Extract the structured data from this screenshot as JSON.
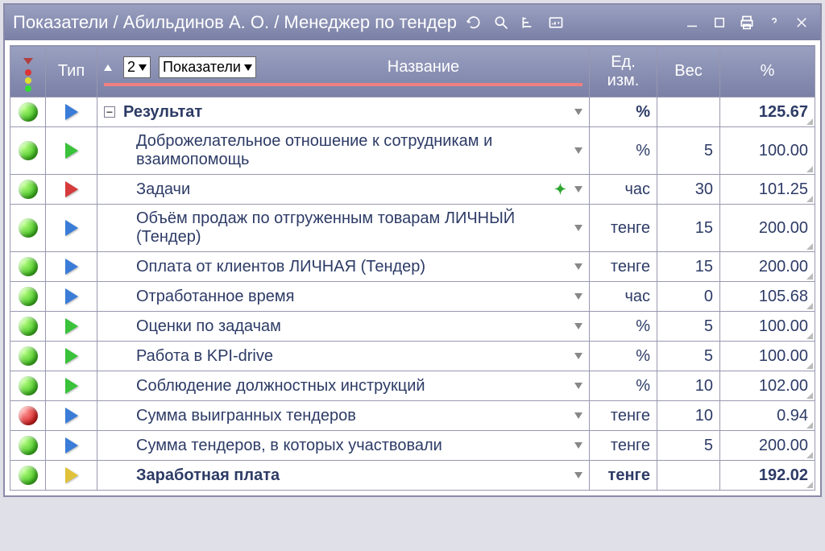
{
  "titlebar": {
    "title": "Показатели / Абильдинов А. О. / Менеджер по тендер"
  },
  "header": {
    "type_label": "Тип",
    "level_value": "2",
    "branch_label": "Показатели",
    "name_label": "Название",
    "unit_label": "Ед. изм.",
    "weight_label": "Вес",
    "percent_label": "%"
  },
  "rows": [
    {
      "status": "green",
      "type": "blue",
      "bold": true,
      "expand": true,
      "name": "Результат",
      "icon": "",
      "unit": "%",
      "weight": "",
      "pct": "125.67"
    },
    {
      "status": "green",
      "type": "green",
      "bold": false,
      "expand": false,
      "name": "Доброжелательное отношение к сотрудникам и взаимопомощь",
      "icon": "",
      "unit": "%",
      "weight": "5",
      "pct": "100.00"
    },
    {
      "status": "green",
      "type": "red",
      "bold": false,
      "expand": false,
      "name": "Задачи",
      "icon": "plus",
      "unit": "час",
      "weight": "30",
      "pct": "101.25"
    },
    {
      "status": "green",
      "type": "blue",
      "bold": false,
      "expand": false,
      "name": "Объём продаж по отгруженным товарам ЛИЧНЫЙ (Тендер)",
      "icon": "",
      "unit": "тенге",
      "weight": "15",
      "pct": "200.00"
    },
    {
      "status": "green",
      "type": "blue",
      "bold": false,
      "expand": false,
      "name": "Оплата от клиентов ЛИЧНАЯ (Тендер)",
      "icon": "",
      "unit": "тенге",
      "weight": "15",
      "pct": "200.00"
    },
    {
      "status": "green",
      "type": "blue",
      "bold": false,
      "expand": false,
      "name": "Отработанное время",
      "icon": "",
      "unit": "час",
      "weight": "0",
      "pct": "105.68"
    },
    {
      "status": "green",
      "type": "green",
      "bold": false,
      "expand": false,
      "name": "Оценки по задачам",
      "icon": "",
      "unit": "%",
      "weight": "5",
      "pct": "100.00"
    },
    {
      "status": "green",
      "type": "green",
      "bold": false,
      "expand": false,
      "name": "Работа в KPI-drive",
      "icon": "",
      "unit": "%",
      "weight": "5",
      "pct": "100.00"
    },
    {
      "status": "green",
      "type": "green",
      "bold": false,
      "expand": false,
      "name": "Соблюдение должностных инструкций",
      "icon": "",
      "unit": "%",
      "weight": "10",
      "pct": "102.00"
    },
    {
      "status": "red",
      "type": "blue",
      "bold": false,
      "expand": false,
      "name": "Сумма выигранных тендеров",
      "icon": "",
      "unit": "тенге",
      "weight": "10",
      "pct": "0.94"
    },
    {
      "status": "green",
      "type": "blue",
      "bold": false,
      "expand": false,
      "name": "Сумма тендеров, в которых участвовали",
      "icon": "",
      "unit": "тенге",
      "weight": "5",
      "pct": "200.00"
    },
    {
      "status": "green",
      "type": "yellow",
      "bold": true,
      "expand": false,
      "name": "Заработная плата",
      "icon": "",
      "unit": "тенге",
      "weight": "",
      "pct": "192.02"
    }
  ]
}
